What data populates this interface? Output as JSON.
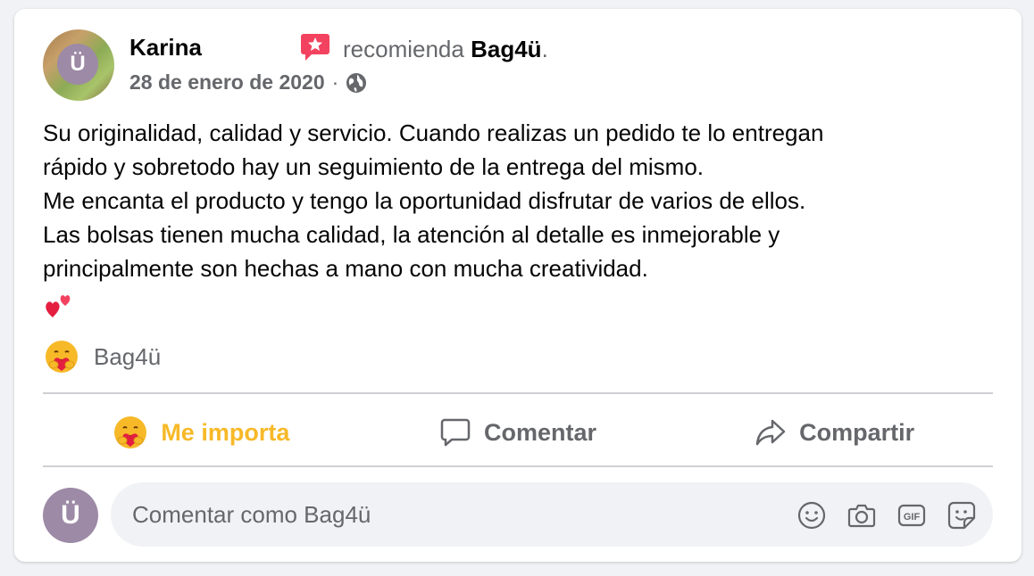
{
  "post": {
    "author": "Karina",
    "recommend_text": "recomienda",
    "page_name": "Bag4ü",
    "period": ".",
    "date": "28 de enero de 2020",
    "dot": "·",
    "avatar_letter": "Ü",
    "body_lines": [
      "Su originalidad, calidad y servicio. Cuando realizas un pedido te lo entregan",
      "rápido y sobretodo hay un seguimiento de la entrega del mismo.",
      "Me encanta el producto y tengo la oportunidad disfrutar de varios de ellos.",
      "Las bolsas tienen mucha calidad, la atención al detalle es inmejorable y",
      "principalmente son hechas a mano con mucha creatividad."
    ]
  },
  "reactions": {
    "name": "Bag4ü",
    "icon": "care-emoji"
  },
  "actions": {
    "care_label": "Me importa",
    "comment_label": "Comentar",
    "share_label": "Compartir"
  },
  "composer": {
    "avatar_letter": "Ü",
    "placeholder": "Comentar como Bag4ü",
    "icons": [
      "smiley-icon",
      "camera-icon",
      "gif-icon",
      "sticker-icon"
    ]
  },
  "colors": {
    "accent_care": "#f7b928",
    "recommend_badge": "#f3425f",
    "secondary_text": "#65676b",
    "avatar_badge": "#9d8aa6"
  }
}
